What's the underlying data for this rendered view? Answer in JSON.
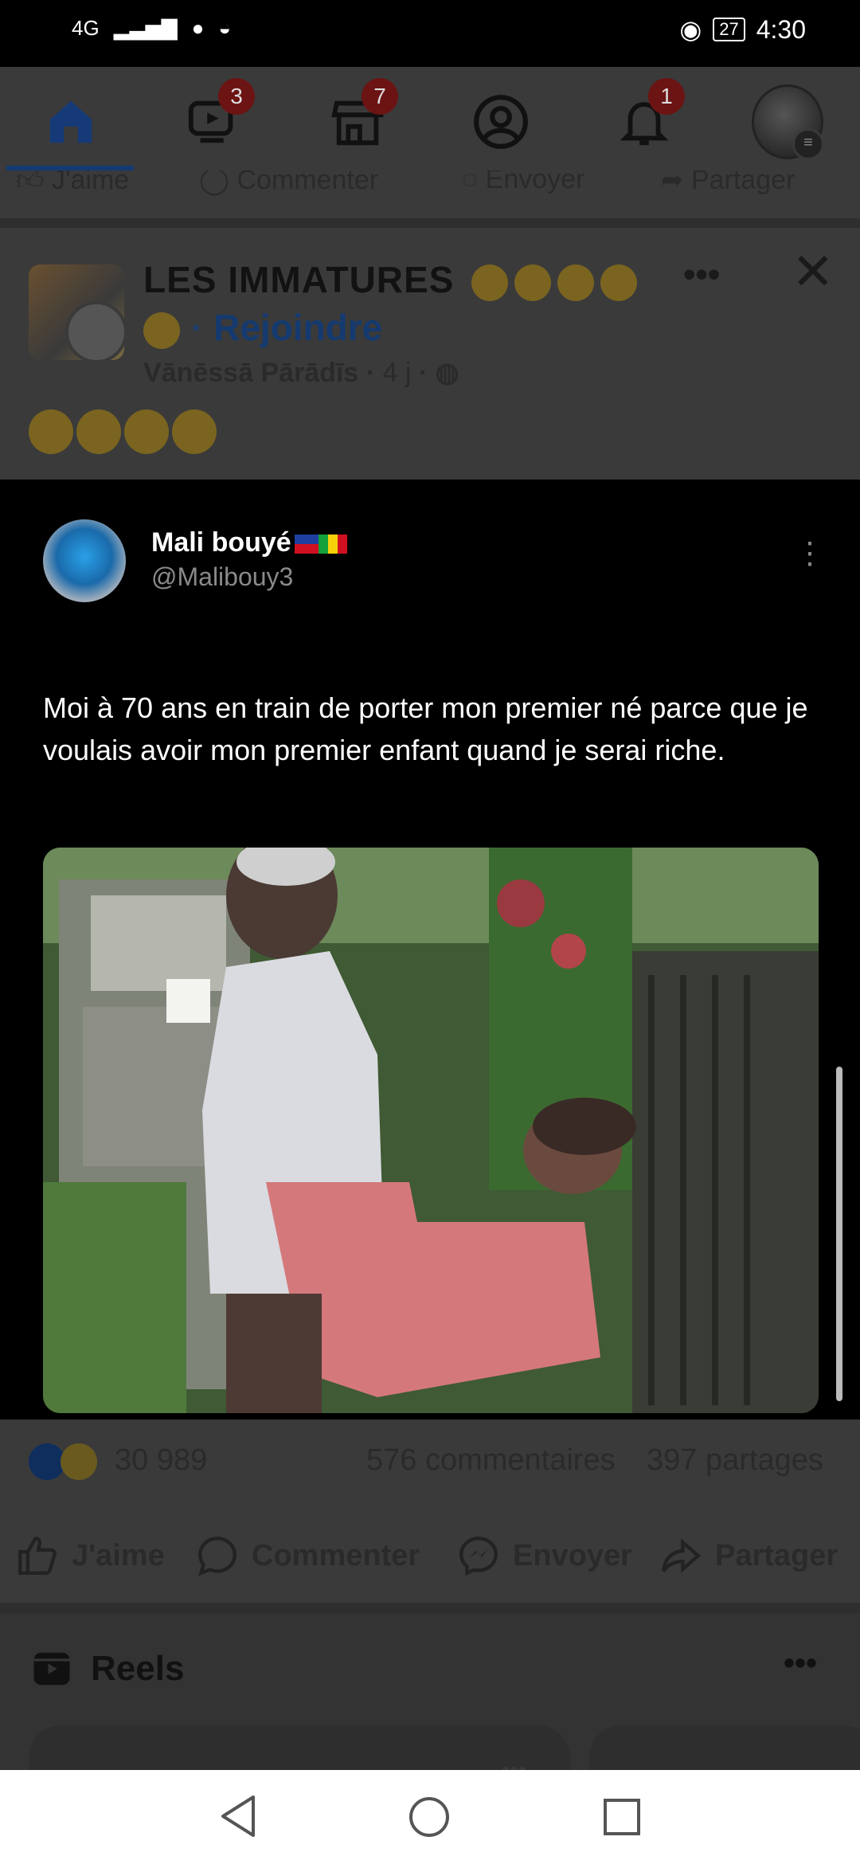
{
  "status_bar": {
    "network": "4G",
    "battery": "27",
    "time": "4:30"
  },
  "tabs": [
    {
      "name": "home",
      "badge": ""
    },
    {
      "name": "video",
      "badge": "3"
    },
    {
      "name": "marketplace",
      "badge": "7"
    },
    {
      "name": "profile",
      "badge": ""
    },
    {
      "name": "notifications",
      "badge": "1"
    },
    {
      "name": "menu",
      "badge": ""
    }
  ],
  "previous_post_actions": {
    "like": "J'aime",
    "comment": "Commenter",
    "send": "Envoyer",
    "share": "Partager"
  },
  "post": {
    "group_name": "LES IMMATURES",
    "join_label": "Rejoindre",
    "author": "Vānēssā Pārādīs",
    "time": "4 j",
    "tweet": {
      "name": "Mali bouyé",
      "handle": "@Malibouy3",
      "text": "Moi à 70 ans en train de porter mon premier né parce que je voulais avoir mon premier enfant quand je serai riche."
    },
    "reactions_count": "30 989",
    "comments_count": "576 commentaires",
    "shares_count": "397 partages",
    "actions": {
      "like": "J'aime",
      "comment": "Commenter",
      "send": "Envoyer",
      "share": "Partager"
    }
  },
  "reels": {
    "title": "Reels"
  },
  "colors": {
    "facebook_blue": "#1877f2",
    "badge_red": "#e41e3f"
  }
}
